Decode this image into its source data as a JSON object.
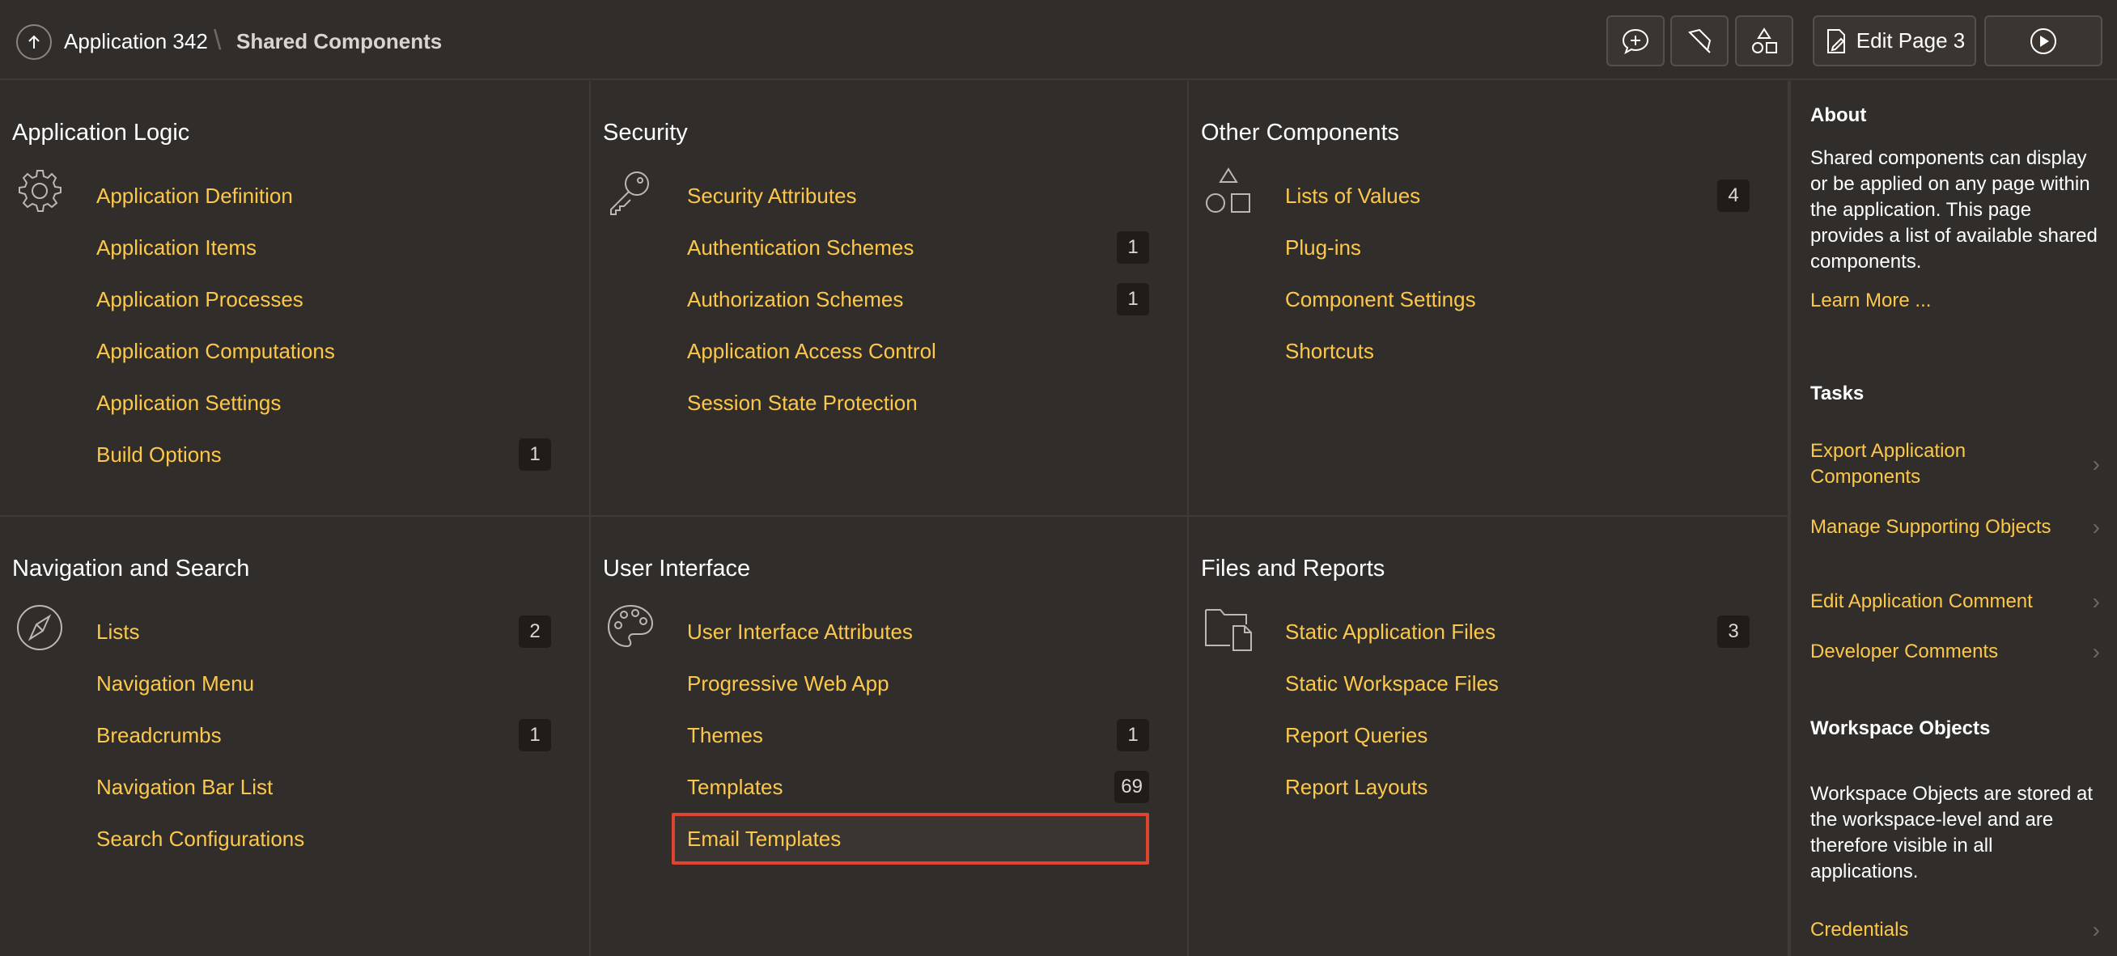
{
  "header": {
    "app_label": "Application 342",
    "separator": "\\",
    "current_label": "Shared Components",
    "edit_page_label": "Edit Page 3"
  },
  "panels": {
    "application_logic": {
      "title": "Application Logic",
      "items": [
        {
          "label": "Application Definition",
          "count": ""
        },
        {
          "label": "Application Items",
          "count": ""
        },
        {
          "label": "Application Processes",
          "count": ""
        },
        {
          "label": "Application Computations",
          "count": ""
        },
        {
          "label": "Application Settings",
          "count": ""
        },
        {
          "label": "Build Options",
          "count": "1"
        }
      ]
    },
    "security": {
      "title": "Security",
      "items": [
        {
          "label": "Security Attributes",
          "count": ""
        },
        {
          "label": "Authentication Schemes",
          "count": "1"
        },
        {
          "label": "Authorization Schemes",
          "count": "1"
        },
        {
          "label": "Application Access Control",
          "count": ""
        },
        {
          "label": "Session State Protection",
          "count": ""
        }
      ]
    },
    "other_components": {
      "title": "Other Components",
      "items": [
        {
          "label": "Lists of Values",
          "count": "4"
        },
        {
          "label": "Plug-ins",
          "count": ""
        },
        {
          "label": "Component Settings",
          "count": ""
        },
        {
          "label": "Shortcuts",
          "count": ""
        }
      ]
    },
    "navigation_search": {
      "title": "Navigation and Search",
      "items": [
        {
          "label": "Lists",
          "count": "2"
        },
        {
          "label": "Navigation Menu",
          "count": ""
        },
        {
          "label": "Breadcrumbs",
          "count": "1"
        },
        {
          "label": "Navigation Bar List",
          "count": ""
        },
        {
          "label": "Search Configurations",
          "count": ""
        }
      ]
    },
    "user_interface": {
      "title": "User Interface",
      "items": [
        {
          "label": "User Interface Attributes",
          "count": ""
        },
        {
          "label": "Progressive Web App",
          "count": ""
        },
        {
          "label": "Themes",
          "count": "1"
        },
        {
          "label": "Templates",
          "count": "69"
        },
        {
          "label": "Email Templates",
          "count": ""
        }
      ]
    },
    "files_reports": {
      "title": "Files and Reports",
      "items": [
        {
          "label": "Static Application Files",
          "count": "3"
        },
        {
          "label": "Static Workspace Files",
          "count": ""
        },
        {
          "label": "Report Queries",
          "count": ""
        },
        {
          "label": "Report Layouts",
          "count": ""
        }
      ]
    }
  },
  "sidebar": {
    "about_title": "About",
    "about_text": "Shared components can display or be applied on any page within the application. This page provides a list of available shared components.",
    "learn_more": "Learn More ...",
    "tasks_title": "Tasks",
    "tasks": [
      "Export Application Components",
      "Manage Supporting Objects",
      "Edit Application Comment",
      "Developer Comments"
    ],
    "workspace_title": "Workspace Objects",
    "workspace_text": "Workspace Objects are stored at the workspace-level and are therefore visible in all applications.",
    "workspace_link": "Credentials"
  },
  "colors": {
    "background": "#312d2a",
    "link": "#fcc84c",
    "highlight": "#e0442e"
  }
}
